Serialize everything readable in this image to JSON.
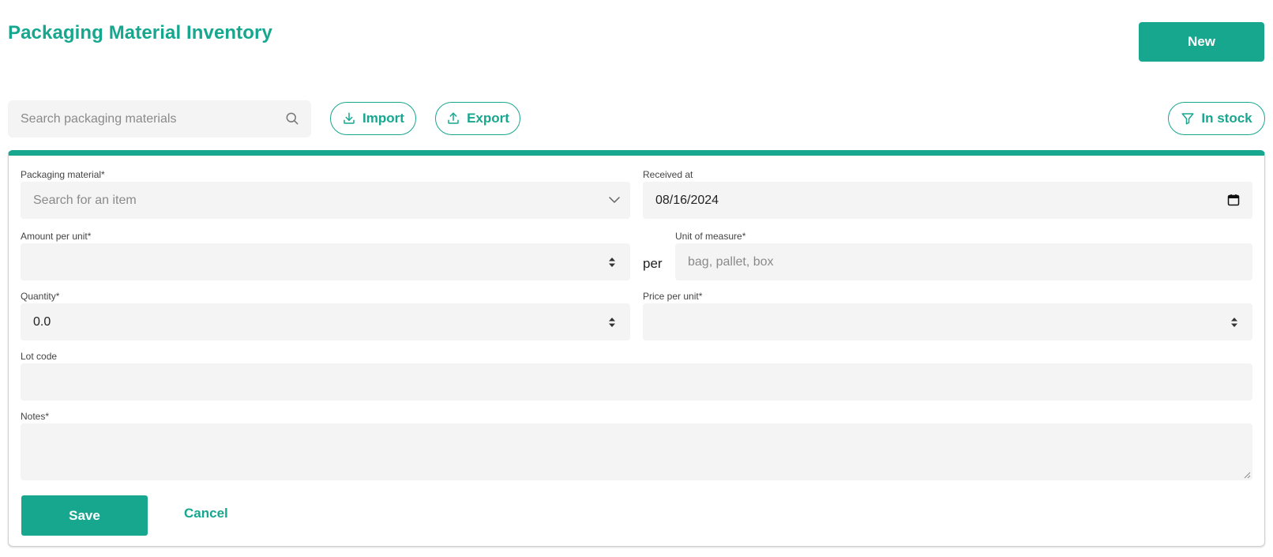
{
  "header": {
    "title": "Packaging Material Inventory",
    "new_label": "New"
  },
  "toolbar": {
    "search_placeholder": "Search packaging materials",
    "import_label": "Import",
    "export_label": "Export",
    "filter_label": "In stock"
  },
  "form": {
    "packaging_material": {
      "label": "Packaging material*",
      "placeholder": "Search for an item",
      "value": ""
    },
    "received_at": {
      "label": "Received at",
      "value": "08/16/2024"
    },
    "amount_per_unit": {
      "label": "Amount per unit*",
      "value": ""
    },
    "per_text": "per",
    "unit_of_measure": {
      "label": "Unit of measure*",
      "placeholder": "bag, pallet, box",
      "value": ""
    },
    "quantity": {
      "label": "Quantity*",
      "value": "0.0"
    },
    "price_per_unit": {
      "label": "Price per unit*",
      "value": ""
    },
    "lot_code": {
      "label": "Lot code",
      "value": ""
    },
    "notes": {
      "label": "Notes*",
      "value": ""
    },
    "save_label": "Save",
    "cancel_label": "Cancel"
  },
  "icons": {
    "search": "search-icon",
    "import": "download-icon",
    "export": "upload-icon",
    "filter": "filter-icon",
    "dropdown": "chevron-down-icon",
    "calendar": "calendar-icon",
    "spinner": "spinner-arrows-icon"
  },
  "colors": {
    "accent": "#17a78f",
    "field_bg": "#f4f4f4",
    "placeholder": "#8a8a8a"
  }
}
